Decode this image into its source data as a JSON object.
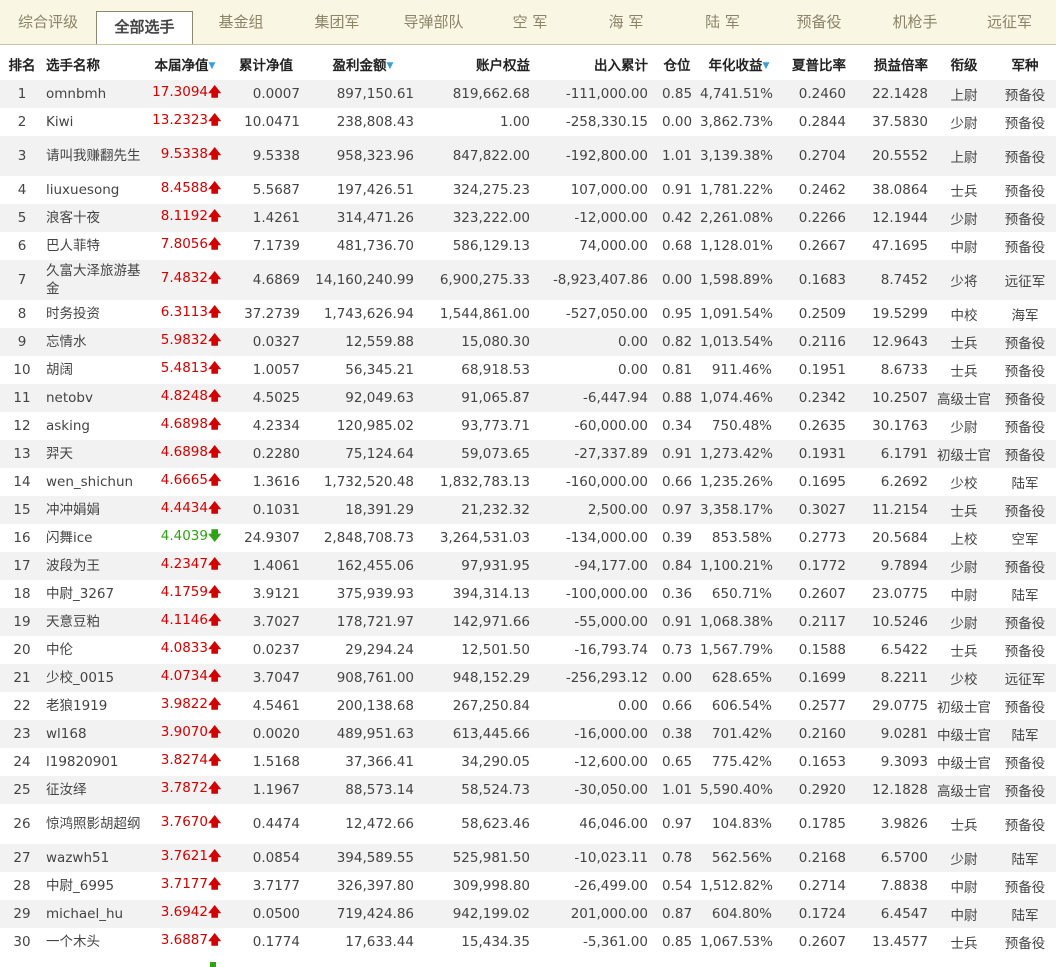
{
  "tabs": [
    "综合评级",
    "全部选手",
    "基金组",
    "集团军",
    "导弹部队",
    "空  军",
    "海  军",
    "陆  军",
    "预备役",
    "机枪手",
    "远征军"
  ],
  "active_tab": 1,
  "headers": {
    "rank": "排名",
    "name": "选手名称",
    "nav": "本届净值",
    "cum_nav": "累计净值",
    "profit": "盈利金额",
    "equity": "账户权益",
    "inout": "出入累计",
    "position": "仓位",
    "annual": "年化收益",
    "sharpe": "夏普比率",
    "pl_ratio": "损益倍率",
    "grade": "衔级",
    "branch": "军种"
  },
  "rows": [
    {
      "rank": "1",
      "name": "omnbmh",
      "nav": "17.3094",
      "dir": "up",
      "cum": "0.0007",
      "profit": "897,150.61",
      "equity": "819,662.68",
      "inout": "-111,000.00",
      "pos": "0.85",
      "annual": "4,741.51%",
      "sharpe": "0.2460",
      "pl": "22.1428",
      "grade": "上尉",
      "branch": "预备役"
    },
    {
      "rank": "2",
      "name": "Kiwi",
      "nav": "13.2323",
      "dir": "up",
      "cum": "10.0471",
      "profit": "238,808.43",
      "equity": "1.00",
      "inout": "-258,330.15",
      "pos": "0.00",
      "annual": "3,862.73%",
      "sharpe": "0.2844",
      "pl": "37.5830",
      "grade": "少尉",
      "branch": "预备役"
    },
    {
      "rank": "3",
      "name": "请叫我赚翻先生",
      "nav": "9.5338",
      "dir": "up",
      "cum": "9.5338",
      "profit": "958,323.96",
      "equity": "847,822.00",
      "inout": "-192,800.00",
      "pos": "1.01",
      "annual": "3,139.38%",
      "sharpe": "0.2704",
      "pl": "20.5552",
      "grade": "上尉",
      "branch": "预备役",
      "tall": true
    },
    {
      "rank": "4",
      "name": "liuxuesong",
      "nav": "8.4588",
      "dir": "up",
      "cum": "5.5687",
      "profit": "197,426.51",
      "equity": "324,275.23",
      "inout": "107,000.00",
      "pos": "0.91",
      "annual": "1,781.22%",
      "sharpe": "0.2462",
      "pl": "38.0864",
      "grade": "士兵",
      "branch": "预备役"
    },
    {
      "rank": "5",
      "name": "浪客十夜",
      "nav": "8.1192",
      "dir": "up",
      "cum": "1.4261",
      "profit": "314,471.26",
      "equity": "323,222.00",
      "inout": "-12,000.00",
      "pos": "0.42",
      "annual": "2,261.08%",
      "sharpe": "0.2266",
      "pl": "12.1944",
      "grade": "少尉",
      "branch": "预备役"
    },
    {
      "rank": "6",
      "name": "巴人菲特",
      "nav": "7.8056",
      "dir": "up",
      "cum": "7.1739",
      "profit": "481,736.70",
      "equity": "586,129.13",
      "inout": "74,000.00",
      "pos": "0.68",
      "annual": "1,128.01%",
      "sharpe": "0.2667",
      "pl": "47.1695",
      "grade": "中尉",
      "branch": "预备役"
    },
    {
      "rank": "7",
      "name": "久富大泽旅游基金",
      "nav": "7.4832",
      "dir": "up",
      "cum": "4.6869",
      "profit": "14,160,240.99",
      "equity": "6,900,275.33",
      "inout": "-8,923,407.86",
      "pos": "0.00",
      "annual": "1,598.89%",
      "sharpe": "0.1683",
      "pl": "8.7452",
      "grade": "少将",
      "branch": "远征军",
      "tall": true
    },
    {
      "rank": "8",
      "name": "时务投资",
      "nav": "6.3113",
      "dir": "up",
      "cum": "37.2739",
      "profit": "1,743,626.94",
      "equity": "1,544,861.00",
      "inout": "-527,050.00",
      "pos": "0.95",
      "annual": "1,091.54%",
      "sharpe": "0.2509",
      "pl": "19.5299",
      "grade": "中校",
      "branch": "海军"
    },
    {
      "rank": "9",
      "name": "忘情水",
      "nav": "5.9832",
      "dir": "up",
      "cum": "0.0327",
      "profit": "12,559.88",
      "equity": "15,080.30",
      "inout": "0.00",
      "pos": "0.82",
      "annual": "1,013.54%",
      "sharpe": "0.2116",
      "pl": "12.9643",
      "grade": "士兵",
      "branch": "预备役"
    },
    {
      "rank": "10",
      "name": "胡阔",
      "nav": "5.4813",
      "dir": "up",
      "cum": "1.0057",
      "profit": "56,345.21",
      "equity": "68,918.53",
      "inout": "0.00",
      "pos": "0.81",
      "annual": "911.46%",
      "sharpe": "0.1951",
      "pl": "8.6733",
      "grade": "士兵",
      "branch": "预备役"
    },
    {
      "rank": "11",
      "name": "netobv",
      "nav": "4.8248",
      "dir": "up",
      "cum": "4.5025",
      "profit": "92,049.63",
      "equity": "91,065.87",
      "inout": "-6,447.94",
      "pos": "0.88",
      "annual": "1,074.46%",
      "sharpe": "0.2342",
      "pl": "10.2507",
      "grade": "高级士官",
      "branch": "预备役"
    },
    {
      "rank": "12",
      "name": "asking",
      "nav": "4.6898",
      "dir": "up",
      "cum": "4.2334",
      "profit": "120,985.02",
      "equity": "93,773.71",
      "inout": "-60,000.00",
      "pos": "0.34",
      "annual": "750.48%",
      "sharpe": "0.2635",
      "pl": "30.1763",
      "grade": "少尉",
      "branch": "预备役"
    },
    {
      "rank": "13",
      "name": "羿天",
      "nav": "4.6898",
      "dir": "up",
      "cum": "0.2280",
      "profit": "75,124.64",
      "equity": "59,073.65",
      "inout": "-27,337.89",
      "pos": "0.91",
      "annual": "1,273.42%",
      "sharpe": "0.1931",
      "pl": "6.1791",
      "grade": "初级士官",
      "branch": "预备役"
    },
    {
      "rank": "14",
      "name": "wen_shichun",
      "nav": "4.6665",
      "dir": "up",
      "cum": "1.3616",
      "profit": "1,732,520.48",
      "equity": "1,832,783.13",
      "inout": "-160,000.00",
      "pos": "0.66",
      "annual": "1,235.26%",
      "sharpe": "0.1695",
      "pl": "6.2692",
      "grade": "少校",
      "branch": "陆军"
    },
    {
      "rank": "15",
      "name": "冲冲娟娟",
      "nav": "4.4434",
      "dir": "up",
      "cum": "0.1031",
      "profit": "18,391.29",
      "equity": "21,232.32",
      "inout": "2,500.00",
      "pos": "0.97",
      "annual": "3,358.17%",
      "sharpe": "0.3027",
      "pl": "11.2154",
      "grade": "士兵",
      "branch": "预备役"
    },
    {
      "rank": "16",
      "name": "闪舞ice",
      "nav": "4.4039",
      "dir": "down",
      "cum": "24.9307",
      "profit": "2,848,708.73",
      "equity": "3,264,531.03",
      "inout": "-134,000.00",
      "pos": "0.39",
      "annual": "853.58%",
      "sharpe": "0.2773",
      "pl": "20.5684",
      "grade": "上校",
      "branch": "空军"
    },
    {
      "rank": "17",
      "name": "波段为王",
      "nav": "4.2347",
      "dir": "up",
      "cum": "1.4061",
      "profit": "162,455.06",
      "equity": "97,931.95",
      "inout": "-94,177.00",
      "pos": "0.84",
      "annual": "1,100.21%",
      "sharpe": "0.1772",
      "pl": "9.7894",
      "grade": "少尉",
      "branch": "预备役"
    },
    {
      "rank": "18",
      "name": "中尉_3267",
      "nav": "4.1759",
      "dir": "up",
      "cum": "3.9121",
      "profit": "375,939.93",
      "equity": "394,314.13",
      "inout": "-100,000.00",
      "pos": "0.36",
      "annual": "650.71%",
      "sharpe": "0.2607",
      "pl": "23.0775",
      "grade": "中尉",
      "branch": "陆军"
    },
    {
      "rank": "19",
      "name": "天意豆粕",
      "nav": "4.1146",
      "dir": "up",
      "cum": "3.7027",
      "profit": "178,721.97",
      "equity": "142,971.66",
      "inout": "-55,000.00",
      "pos": "0.91",
      "annual": "1,068.38%",
      "sharpe": "0.2117",
      "pl": "10.5246",
      "grade": "少尉",
      "branch": "预备役"
    },
    {
      "rank": "20",
      "name": "中伦",
      "nav": "4.0833",
      "dir": "up",
      "cum": "0.0237",
      "profit": "29,294.24",
      "equity": "12,501.50",
      "inout": "-16,793.74",
      "pos": "0.73",
      "annual": "1,567.79%",
      "sharpe": "0.1588",
      "pl": "6.5422",
      "grade": "士兵",
      "branch": "预备役"
    },
    {
      "rank": "21",
      "name": "少校_0015",
      "nav": "4.0734",
      "dir": "up",
      "cum": "3.7047",
      "profit": "908,761.00",
      "equity": "948,152.29",
      "inout": "-256,293.12",
      "pos": "0.00",
      "annual": "628.65%",
      "sharpe": "0.1699",
      "pl": "8.2211",
      "grade": "少校",
      "branch": "远征军"
    },
    {
      "rank": "22",
      "name": "老狼1919",
      "nav": "3.9822",
      "dir": "up",
      "cum": "4.5461",
      "profit": "200,138.68",
      "equity": "267,250.84",
      "inout": "0.00",
      "pos": "0.66",
      "annual": "606.54%",
      "sharpe": "0.2577",
      "pl": "29.0775",
      "grade": "初级士官",
      "branch": "预备役"
    },
    {
      "rank": "23",
      "name": "wl168",
      "nav": "3.9070",
      "dir": "up",
      "cum": "0.0020",
      "profit": "489,951.63",
      "equity": "613,445.66",
      "inout": "-16,000.00",
      "pos": "0.38",
      "annual": "701.42%",
      "sharpe": "0.2160",
      "pl": "9.0281",
      "grade": "中级士官",
      "branch": "陆军"
    },
    {
      "rank": "24",
      "name": "l19820901",
      "nav": "3.8274",
      "dir": "up",
      "cum": "1.5168",
      "profit": "37,366.41",
      "equity": "34,290.05",
      "inout": "-12,600.00",
      "pos": "0.65",
      "annual": "775.42%",
      "sharpe": "0.1653",
      "pl": "9.3093",
      "grade": "中级士官",
      "branch": "预备役"
    },
    {
      "rank": "25",
      "name": "征汝绎",
      "nav": "3.7872",
      "dir": "up",
      "cum": "1.1967",
      "profit": "88,573.14",
      "equity": "58,524.73",
      "inout": "-30,050.00",
      "pos": "1.01",
      "annual": "5,590.40%",
      "sharpe": "0.2920",
      "pl": "12.1828",
      "grade": "高级士官",
      "branch": "预备役"
    },
    {
      "rank": "26",
      "name": "惊鸿照影胡超纲",
      "nav": "3.7670",
      "dir": "up",
      "cum": "0.4474",
      "profit": "12,472.66",
      "equity": "58,623.46",
      "inout": "46,046.00",
      "pos": "0.97",
      "annual": "104.83%",
      "sharpe": "0.1785",
      "pl": "3.9826",
      "grade": "士兵",
      "branch": "预备役",
      "tall": true
    },
    {
      "rank": "27",
      "name": "wazwh51",
      "nav": "3.7621",
      "dir": "up",
      "cum": "0.0854",
      "profit": "394,589.55",
      "equity": "525,981.50",
      "inout": "-10,023.11",
      "pos": "0.78",
      "annual": "562.56%",
      "sharpe": "0.2168",
      "pl": "6.5700",
      "grade": "少尉",
      "branch": "陆军"
    },
    {
      "rank": "28",
      "name": "中尉_6995",
      "nav": "3.7177",
      "dir": "up",
      "cum": "3.7177",
      "profit": "326,397.80",
      "equity": "309,998.80",
      "inout": "-26,499.00",
      "pos": "0.54",
      "annual": "1,512.82%",
      "sharpe": "0.2714",
      "pl": "7.8838",
      "grade": "中尉",
      "branch": "预备役"
    },
    {
      "rank": "29",
      "name": "michael_hu",
      "nav": "3.6942",
      "dir": "up",
      "cum": "0.0500",
      "profit": "719,424.86",
      "equity": "942,199.02",
      "inout": "201,000.00",
      "pos": "0.87",
      "annual": "604.80%",
      "sharpe": "0.1724",
      "pl": "6.4547",
      "grade": "中尉",
      "branch": "陆军"
    },
    {
      "rank": "30",
      "name": "一个木头",
      "nav": "3.6887",
      "dir": "up",
      "cum": "0.1774",
      "profit": "17,633.44",
      "equity": "15,434.35",
      "inout": "-5,361.00",
      "pos": "0.85",
      "annual": "1,067.53%",
      "sharpe": "0.2607",
      "pl": "13.4577",
      "grade": "士兵",
      "branch": "预备役"
    }
  ],
  "colors": {
    "up": "#d40000",
    "down": "#2ea313",
    "tab_bar": "#faf6e4",
    "odd_row": "#f2f2f2",
    "sort_icon": "#3aa0d8"
  },
  "icons": {
    "up": "arrow-up-icon",
    "down": "arrow-down-icon",
    "sort": "sort-desc-icon"
  }
}
